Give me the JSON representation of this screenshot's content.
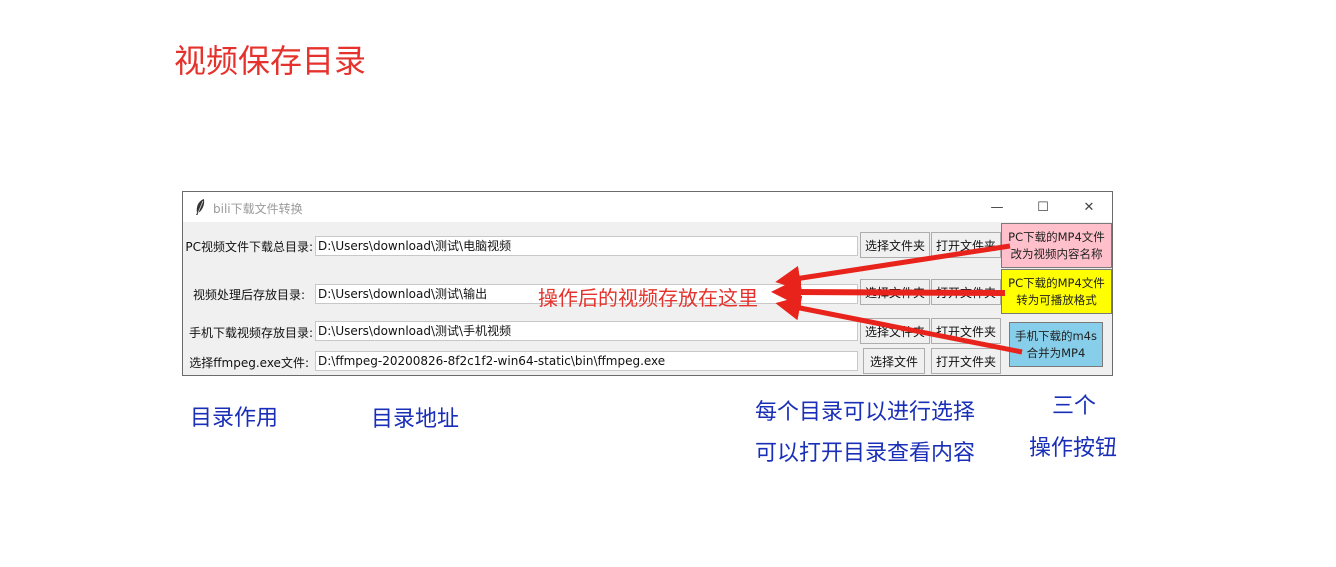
{
  "annotations": {
    "title": "视频保存目录",
    "center_note": "操作后的视频存放在这里",
    "dir_purpose": "目录作用",
    "dir_address": "目录地址",
    "select_note_1": "每个目录可以进行选择",
    "select_note_2": "可以打开目录查看内容",
    "buttons_note_1": "三个",
    "buttons_note_2": "操作按钮"
  },
  "window": {
    "title": "bili下载文件转换",
    "minimize": "—",
    "maximize": "☐",
    "close": "✕"
  },
  "rows": [
    {
      "label": "PC视频文件下载总目录:",
      "value": "D:\\Users\\download\\测试\\电脑视频",
      "select_label": "选择文件夹",
      "open_label": "打开文件夹"
    },
    {
      "label": "视频处理后存放目录:",
      "value": "D:\\Users\\download\\测试\\输出",
      "select_label": "选择文件夹",
      "open_label": "打开文件夹"
    },
    {
      "label": "手机下载视频存放目录:",
      "value": "D:\\Users\\download\\测试\\手机视频",
      "select_label": "选择文件夹",
      "open_label": "打开文件夹"
    },
    {
      "label": "选择ffmpeg.exe文件:",
      "value": "D:\\ffmpeg-20200826-8f2c1f2-win64-static\\bin\\ffmpeg.exe",
      "select_label": "选择文件",
      "open_label": "打开文件夹"
    }
  ],
  "actions": [
    {
      "line1": "PC下载的MP4文件",
      "line2": "改为视频内容名称",
      "color": "#ffc0cb"
    },
    {
      "line1": "PC下载的MP4文件",
      "line2": "转为可播放格式",
      "color": "#ffff00"
    },
    {
      "line1": "手机下载的m4s",
      "line2": "合并为MP4",
      "color": "#87ceeb"
    }
  ],
  "colors": {
    "annotation_red": "#e5322d",
    "annotation_blue": "#1a2fb8"
  }
}
